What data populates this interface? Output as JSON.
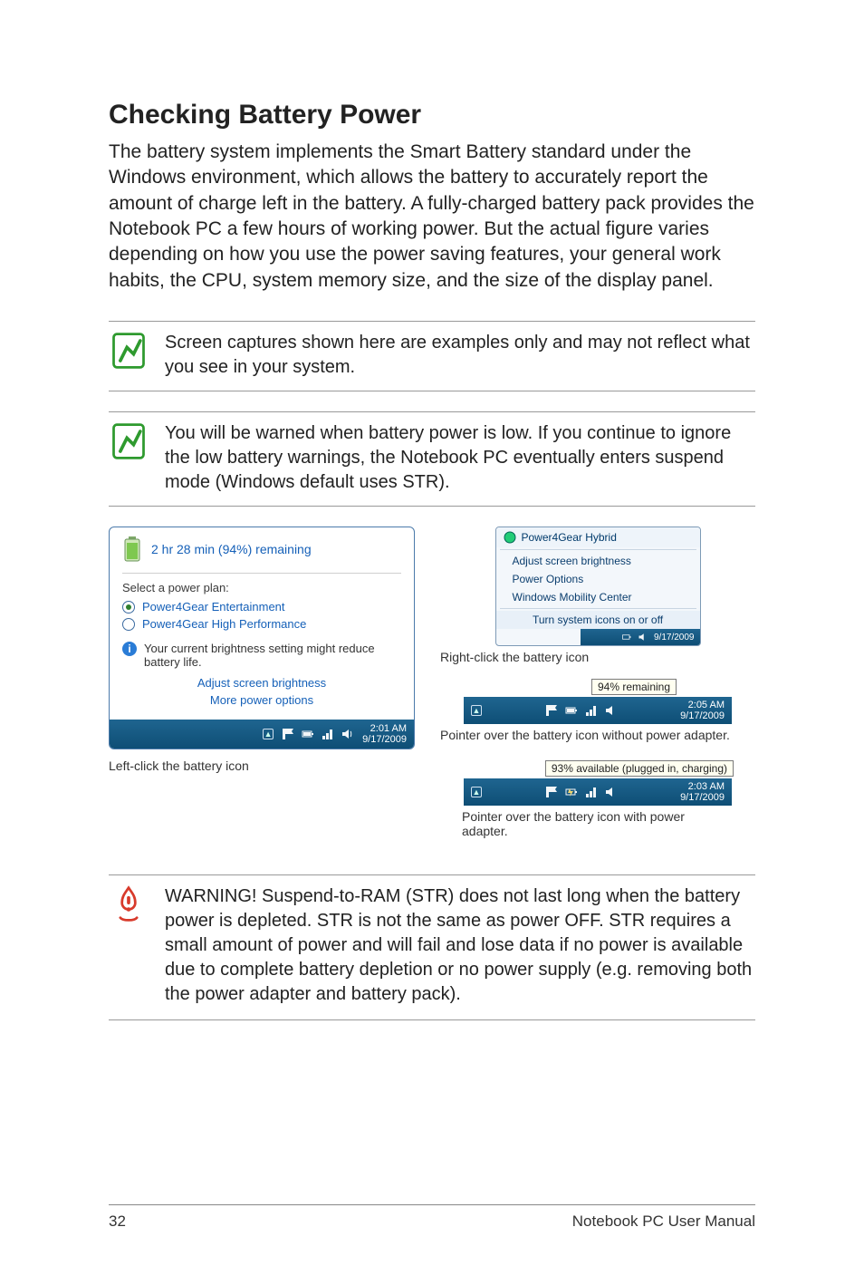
{
  "title": "Checking Battery Power",
  "intro": "The battery system implements the Smart Battery standard under the Windows environment, which allows the battery to accurately report the amount of charge left in the battery. A fully-charged battery pack provides the Notebook PC a few hours of working power. But the actual figure varies depending on how you use the power saving features, your general work habits, the CPU, system memory size, and the size of the display panel.",
  "notes": {
    "n1": "Screen captures shown here are examples only and may not reflect what you see in your system.",
    "n2": "You will be warned when battery power is low. If you continue to ignore the low battery warnings, the Notebook PC eventually enters suspend mode (Windows default uses STR)."
  },
  "left_panel": {
    "remaining": "2 hr 28 min (94%) remaining",
    "plan_header": "Select a power plan:",
    "plan1": "Power4Gear Entertainment",
    "plan2": "Power4Gear High Performance",
    "info": "Your current brightness setting might reduce battery life.",
    "link1": "Adjust screen brightness",
    "link2": "More power options",
    "clock_time": "2:01 AM",
    "clock_date": "9/17/2009",
    "caption": "Left-click the battery icon"
  },
  "context_menu": {
    "head": "Power4Gear Hybrid",
    "i1": "Adjust screen brightness",
    "i2": "Power Options",
    "i3": "Windows Mobility Center",
    "i4": "Turn system icons on or off",
    "tray_date": "9/17/2009",
    "caption": "Right-click the battery icon"
  },
  "hover_unplugged": {
    "tooltip": "94% remaining",
    "time": "2:05 AM",
    "date": "9/17/2009",
    "caption": "Pointer over the battery icon without power adapter."
  },
  "hover_plugged": {
    "tooltip": "93% available (plugged in, charging)",
    "time": "2:03 AM",
    "date": "9/17/2009",
    "caption": "Pointer over the battery icon with power adapter."
  },
  "warning": "WARNING!  Suspend-to-RAM (STR) does not last long when the battery power is depleted. STR is not the same as power OFF. STR requires a small amount of power and will fail and lose data if no power is available due to complete battery depletion or no power supply (e.g. removing both the power adapter and battery pack).",
  "footer": {
    "page": "32",
    "book": "Notebook PC User Manual"
  }
}
